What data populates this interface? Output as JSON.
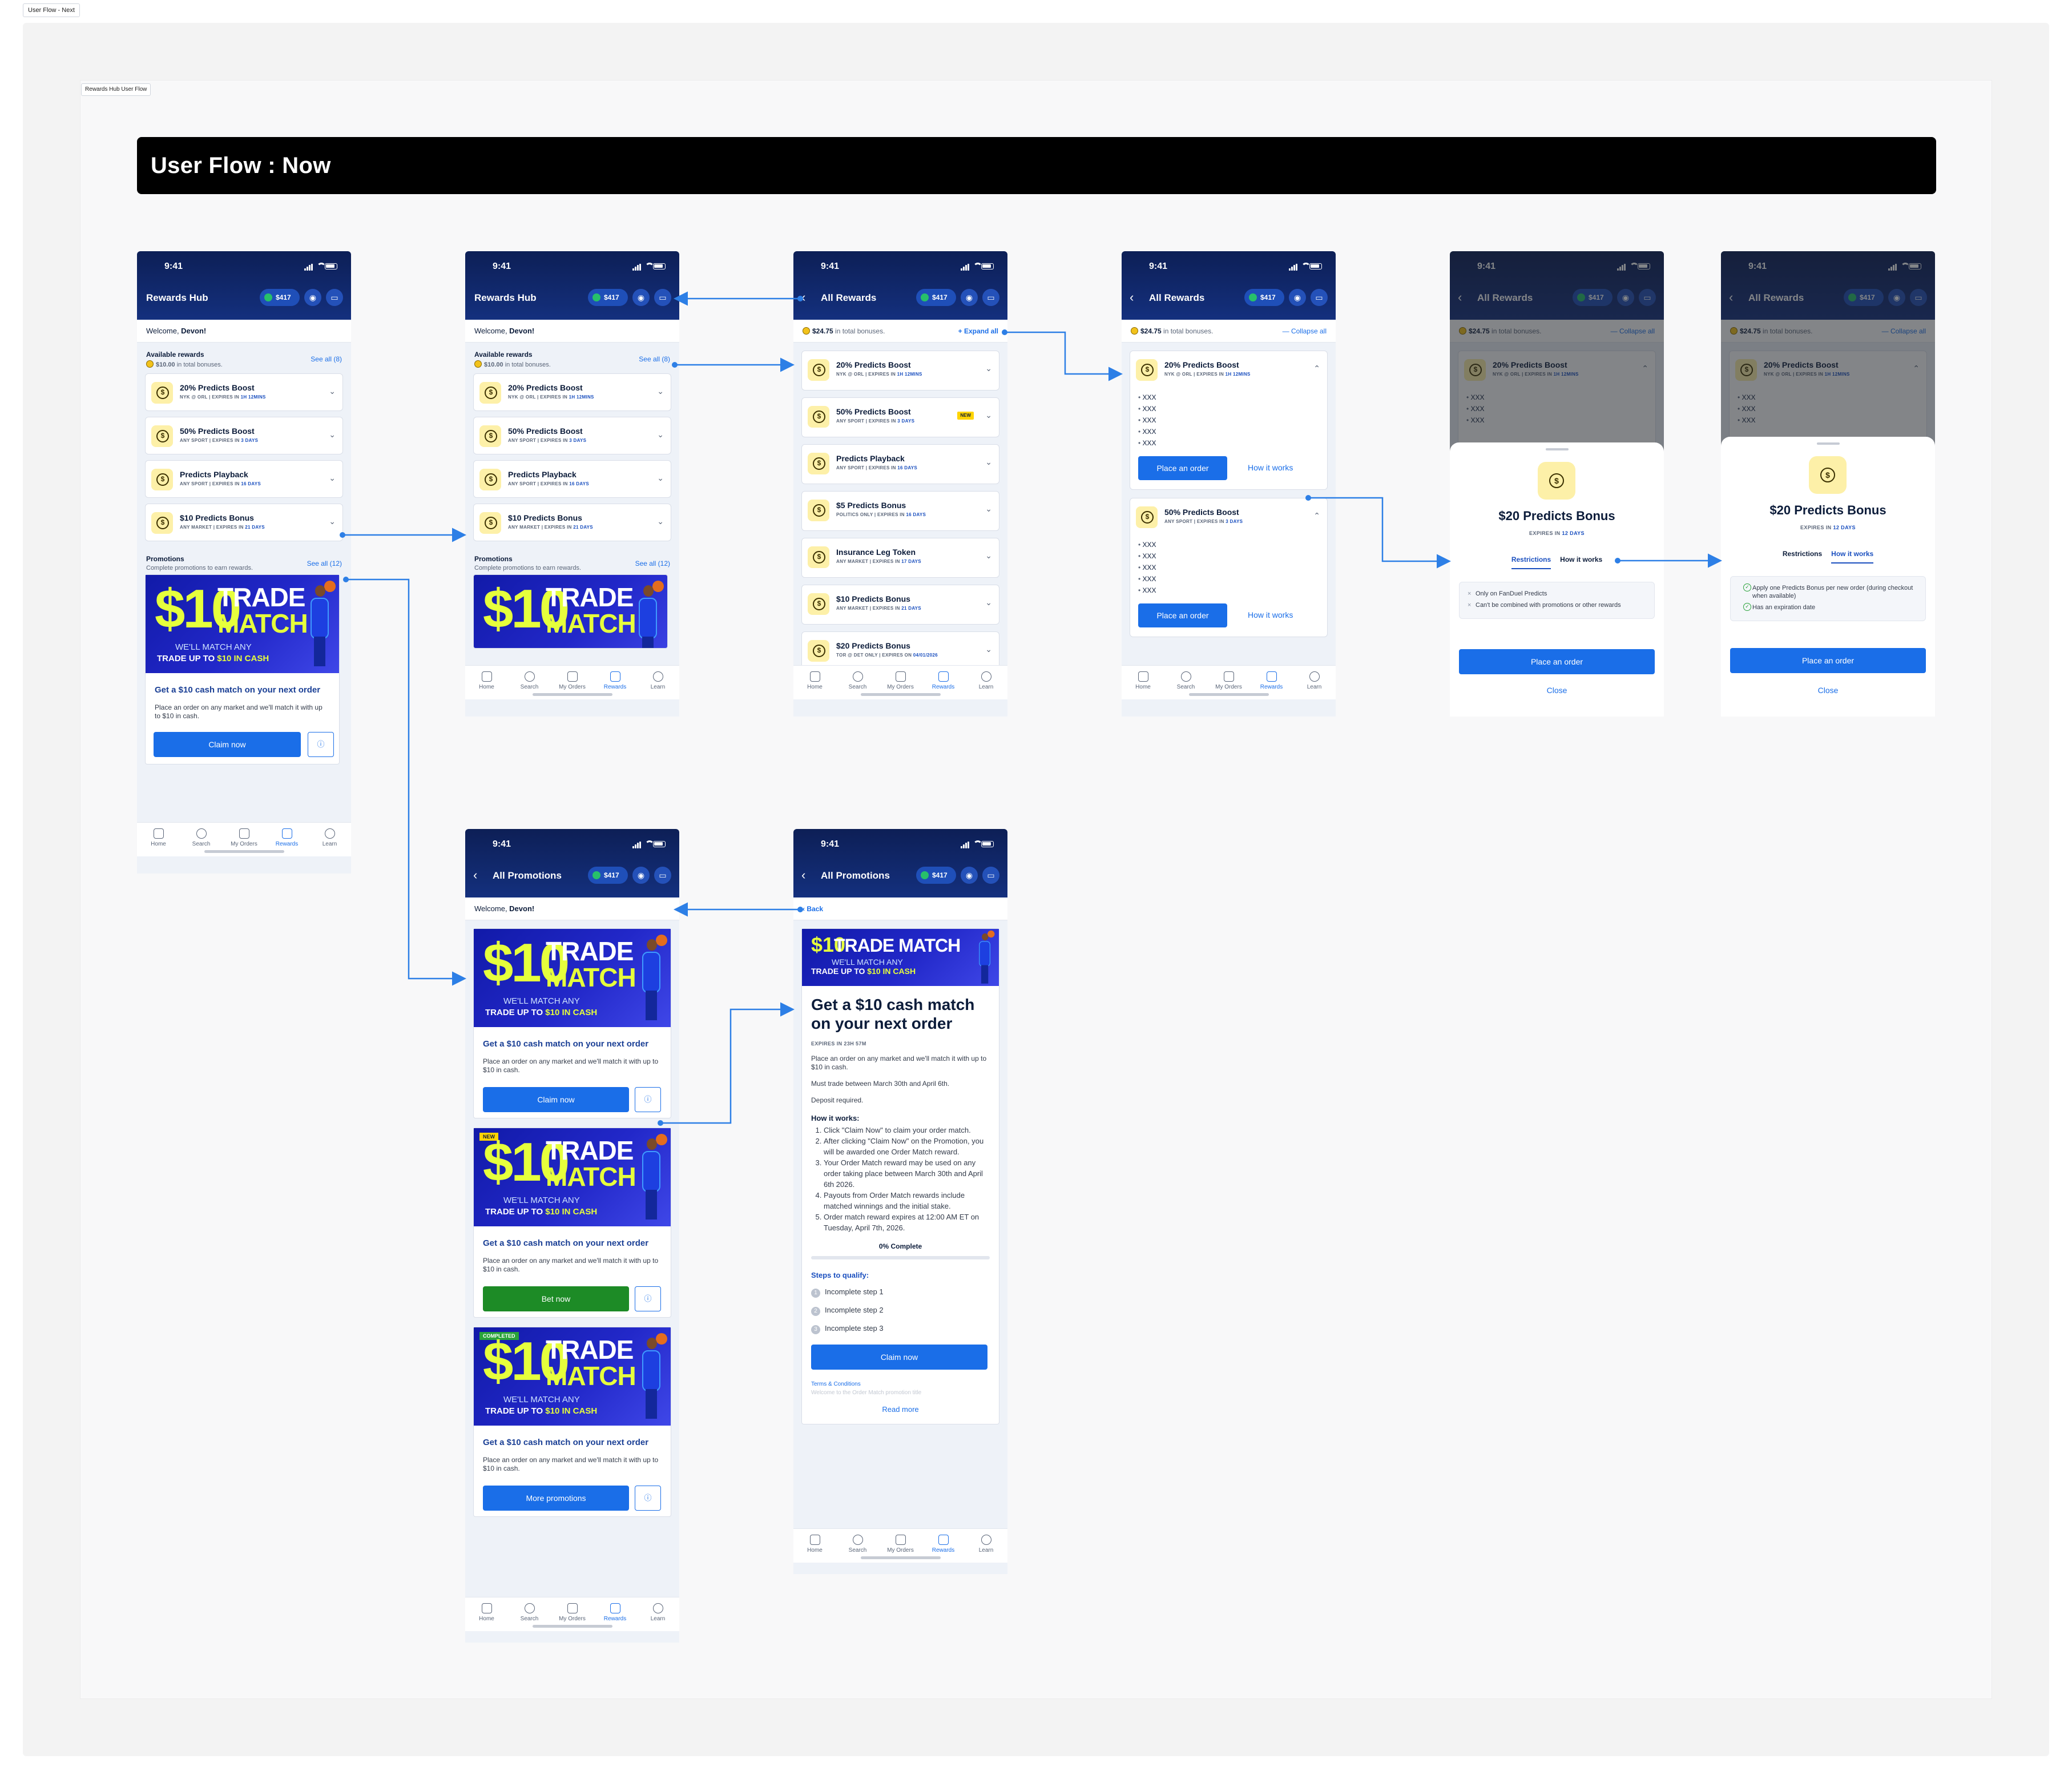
{
  "page_tag": "User Flow - Next",
  "frame_tag": "Rewards Hub User Flow",
  "banner_title": "User Flow : Now",
  "status_time": "9:41",
  "balance": "$417",
  "colors": {
    "brand_navy": "#0d1f56",
    "primary_blue": "#1a6ee8",
    "success_green": "#1d8b26",
    "bonus_yellow": "#f2c21b",
    "promo_lime": "#e6ff3c"
  },
  "icons": {
    "coin": "dollar-coin-icon",
    "chevron": "chevron-down-icon",
    "back": "chevron-left-icon",
    "info": "info-icon",
    "account": "account-icon",
    "chat": "chat-icon"
  },
  "tabbar": [
    "Home",
    "Search",
    "My Orders",
    "Rewards",
    "Learn"
  ],
  "rewards_hub": {
    "title": "Rewards Hub",
    "welcome_prefix": "Welcome, ",
    "welcome_name": "Devon!",
    "available_title": "Available rewards",
    "available_amount": "$10.00",
    "available_suffix": " in total bonuses.",
    "see_all_rewards": "See all (8)",
    "promotions_title": "Promotions",
    "promotions_sub": "Complete promotions to earn rewards.",
    "see_all_promotions": "See all (12)",
    "cards": [
      {
        "title": "20% Predicts Boost",
        "meta_a": "NYK @ ORL",
        "meta_b": "EXPIRES IN ",
        "meta_em": "1H 12MINS"
      },
      {
        "title": "50% Predicts Boost",
        "meta_a": "ANY SPORT",
        "meta_b": "EXPIRES IN ",
        "meta_em": "3 DAYS"
      },
      {
        "title": "Predicts Playback",
        "meta_a": "ANY SPORT",
        "meta_b": "EXPIRES IN ",
        "meta_em": "16 DAYS"
      },
      {
        "title": "$10 Predicts Bonus",
        "meta_a": "ANY MARKET",
        "meta_b": "EXPIRES IN ",
        "meta_em": "21 DAYS"
      }
    ]
  },
  "promo": {
    "big": "$10",
    "word1": "TRADE",
    "word2": "MATCH",
    "sub1": "WE'LL MATCH ANY",
    "sub2_a": "TRADE UP TO ",
    "sub2_b": "$10 IN CASH",
    "title": "Get a $10 cash match on your next order",
    "body": "Place an order on any market and we'll match it with up to $10 in cash.",
    "claim_label": "Claim now",
    "bet_label": "Bet now",
    "more_label": "More promotions",
    "new_tag": "NEW",
    "completed_tag": "COMPLETED"
  },
  "all_rewards": {
    "title": "All Rewards",
    "total_amount": "$24.75",
    "total_suffix": " in total bonuses.",
    "expand_all": "+ Expand all",
    "collapse_all": "— Collapse all",
    "new_badge": "NEW",
    "cards": [
      {
        "title": "20% Predicts Boost",
        "meta_a": "NYK @ ORL",
        "meta_b": "EXPIRES IN ",
        "meta_em": "1H 12MINS"
      },
      {
        "title": "50% Predicts Boost",
        "meta_a": "ANY SPORT",
        "meta_b": "EXPIRES IN ",
        "meta_em": "3 DAYS"
      },
      {
        "title": "Predicts Playback",
        "meta_a": "ANY SPORT",
        "meta_b": "EXPIRES IN ",
        "meta_em": "16 DAYS"
      },
      {
        "title": "$5 Predicts Bonus",
        "meta_a": "POLITICS ONLY",
        "meta_b": "EXPIRES IN ",
        "meta_em": "16 DAYS"
      },
      {
        "title": "Insurance Leg Token",
        "meta_a": "ANY MARKET",
        "meta_b": "EXPIRES IN ",
        "meta_em": "17 DAYS"
      },
      {
        "title": "$10 Predicts Bonus",
        "meta_a": "ANY MARKET",
        "meta_b": "EXPIRES IN ",
        "meta_em": "21 DAYS"
      },
      {
        "title": "$20 Predicts Bonus",
        "meta_a": "TOR @ DET ONLY",
        "meta_b": "EXPIRES ON ",
        "meta_em": "04/01/2026"
      }
    ],
    "placeholder": "XXX",
    "place_order": "Place an order",
    "how_it_works": "How it works"
  },
  "sheet": {
    "title": "$20 Predicts Bonus",
    "expires_a": "EXPIRES IN ",
    "expires_b": "12 DAYS",
    "tab_restrictions": "Restrictions",
    "tab_how": "How it works",
    "restrictions": [
      "Only on FanDuel Predicts",
      "Can't be combined with promotions or other rewards"
    ],
    "how_items": [
      "Apply one Predicts Bonus per new order (during checkout when available)",
      "Has an expiration date"
    ],
    "place_order": "Place an order",
    "close": "Close"
  },
  "all_promotions": {
    "title": "All Promotions",
    "back": "Back"
  },
  "promo_detail": {
    "banner_big": "$10",
    "banner_word": "TRADE MATCH",
    "title": "Get a $10 cash match on your next order",
    "expires": "EXPIRES IN 23H 57M",
    "p1": "Place an order on any market and we'll match it with up to $10 in cash.",
    "p2": "Must trade between March 30th and April 6th.",
    "p3": "Deposit required.",
    "how_title": "How it works:",
    "steps": [
      "Click \"Claim Now\" to claim your order match.",
      "After clicking \"Claim Now\" on the Promotion, you will be awarded one Order Match reward.",
      "Your Order Match reward may be used on any order taking place between March 30th and April 6th 2026.",
      "Payouts from Order Match rewards include matched winnings and the initial stake.",
      "Order match reward expires at 12:00 AM ET on Tuesday, April 7th, 2026."
    ],
    "progress": 0,
    "progress_label": "0% Complete",
    "qualify_title": "Steps to qualify:",
    "qualify": [
      "Incomplete step 1",
      "Incomplete step 2",
      "Incomplete step 3"
    ],
    "claim": "Claim now",
    "terms": "Terms & Conditions",
    "fade_text": "Welcome to the Order Match promotion title",
    "read_more": "Read more"
  }
}
